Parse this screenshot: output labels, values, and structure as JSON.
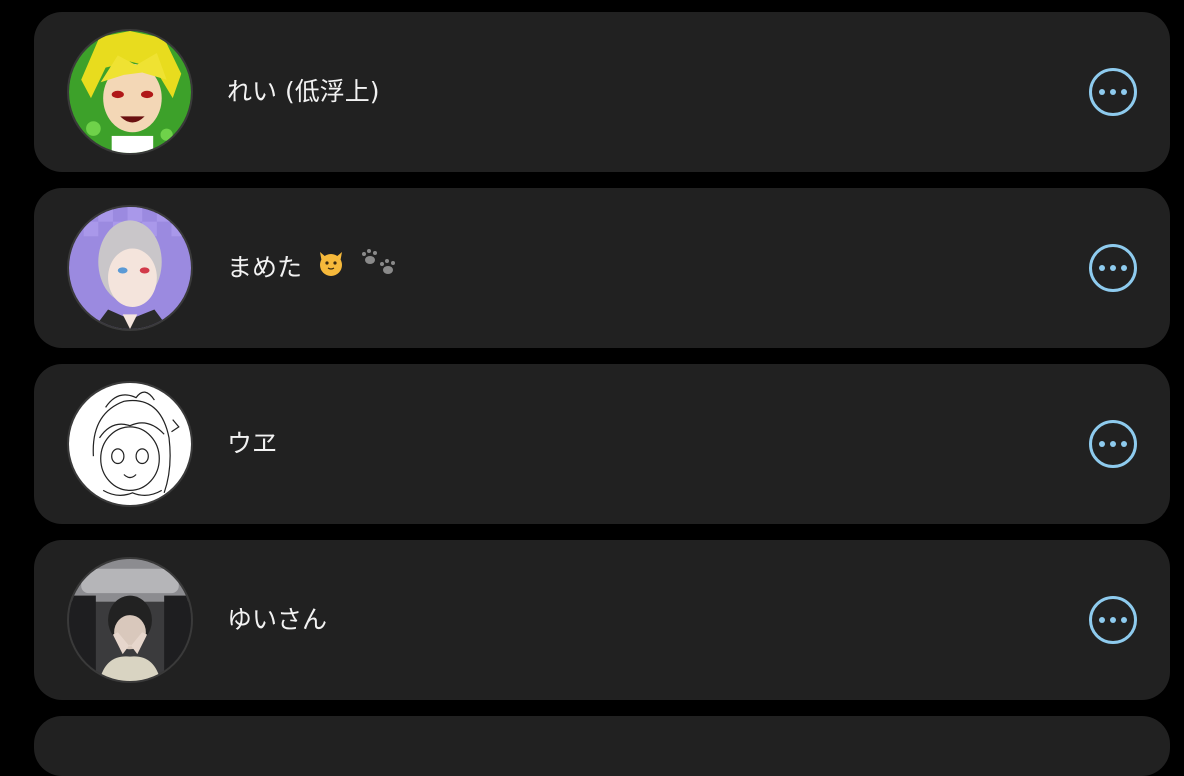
{
  "friends": [
    {
      "name": "れい (低浮上)",
      "avatar": "anime-blond-character-avatar",
      "emoji": []
    },
    {
      "name": "まめた",
      "avatar": "anime-silver-hair-character-avatar",
      "emoji": [
        "cat-face-emoji",
        "paw-prints-emoji"
      ]
    },
    {
      "name": "ウヱ",
      "avatar": "sketch-anime-girl-avatar",
      "emoji": []
    },
    {
      "name": "ゆいさん",
      "avatar": "car-selfie-photo-avatar",
      "emoji": []
    }
  ],
  "icons": {
    "more": "more-options-icon"
  },
  "colors": {
    "background": "#000000",
    "card": "#212121",
    "text": "#f2f2f2",
    "accent": "#8ecbee"
  }
}
